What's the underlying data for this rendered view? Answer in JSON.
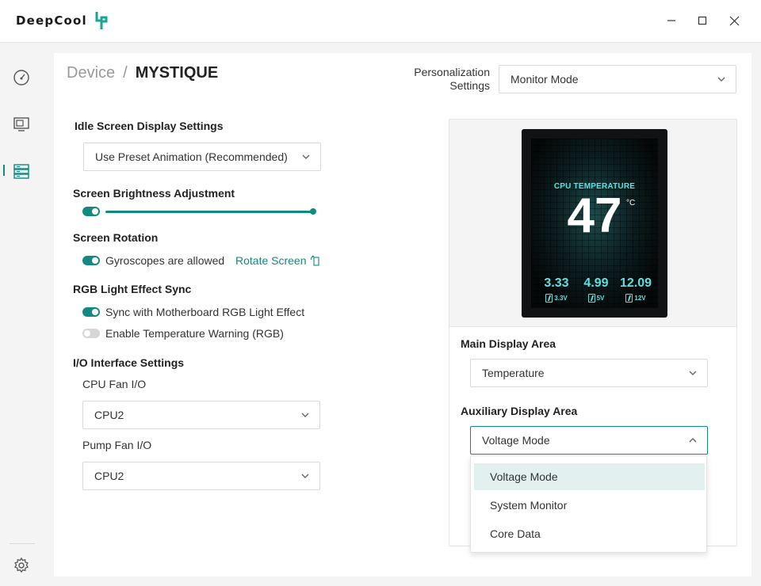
{
  "app": {
    "brand": "DeepCool"
  },
  "sidebar": {
    "items": [
      {
        "name": "dashboard"
      },
      {
        "name": "display"
      },
      {
        "name": "devices",
        "active": true
      }
    ]
  },
  "breadcrumb": {
    "root": "Device",
    "separator": "/",
    "current": "MYSTIQUE"
  },
  "personalization": {
    "label": "Personalization Settings",
    "value": "Monitor Mode"
  },
  "idle_screen": {
    "title": "Idle Screen Display Settings",
    "value": "Use Preset Animation (Recommended)"
  },
  "brightness": {
    "title": "Screen Brightness Adjustment",
    "enabled": true,
    "level_percent": 100
  },
  "rotation": {
    "title": "Screen Rotation",
    "gyro_label": "Gyroscopes are allowed",
    "gyro_enabled": true,
    "rotate_link": "Rotate Screen"
  },
  "rgb": {
    "title": "RGB Light Effect Sync",
    "sync_label": "Sync with Motherboard RGB Light Effect",
    "sync_enabled": true,
    "temp_warning_label": "Enable Temperature Warning (RGB)",
    "temp_warning_enabled": false
  },
  "io": {
    "title": "I/O Interface Settings",
    "cpu_fan_label": "CPU Fan I/O",
    "cpu_fan_value": "CPU2",
    "pump_fan_label": "Pump Fan I/O",
    "pump_fan_value": "CPU2"
  },
  "preview": {
    "title": "CPU TEMPERATURE",
    "temperature": "47",
    "unit": "°C",
    "voltages": [
      {
        "value": "3.33",
        "label": "3.3V"
      },
      {
        "value": "4.99",
        "label": "5V"
      },
      {
        "value": "12.09",
        "label": "12V"
      }
    ]
  },
  "main_display": {
    "label": "Main Display Area",
    "value": "Temperature"
  },
  "aux_display": {
    "label": "Auxiliary Display Area",
    "value": "Voltage Mode",
    "options": [
      "Voltage Mode",
      "System Monitor",
      "Core Data"
    ]
  },
  "colors": {
    "accent": "#128a82",
    "screen_text": "#5ce0e0",
    "selected_bg": "#e3f0f0"
  }
}
